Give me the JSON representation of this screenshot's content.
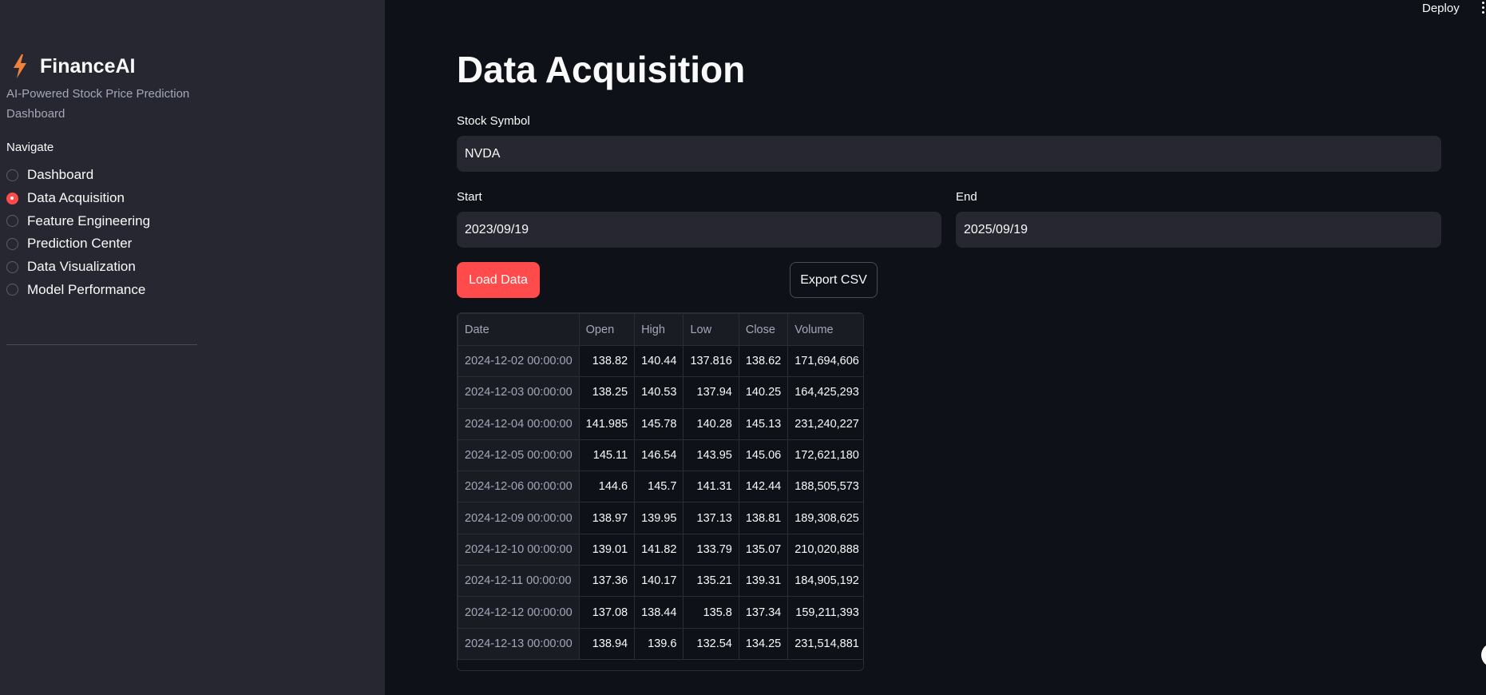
{
  "app": {
    "title": "FinanceAI",
    "tagline": "AI-Powered Stock Price Prediction Dashboard",
    "icon": "lightning-bolt-icon",
    "accent": "#ff4b4b",
    "bolt_color": "#f2823a"
  },
  "sidebar": {
    "nav_label": "Navigate",
    "items": [
      {
        "label": "Dashboard",
        "selected": false
      },
      {
        "label": "Data Acquisition",
        "selected": true
      },
      {
        "label": "Feature Engineering",
        "selected": false
      },
      {
        "label": "Prediction Center",
        "selected": false
      },
      {
        "label": "Data Visualization",
        "selected": false
      },
      {
        "label": "Model Performance",
        "selected": false
      }
    ]
  },
  "header": {
    "deploy_label": "Deploy",
    "menu_icon": "kebab-menu-icon"
  },
  "main": {
    "title": "Data Acquisition",
    "symbol_label": "Stock Symbol",
    "symbol_value": "NVDA",
    "start_label": "Start",
    "start_value": "2023/09/19",
    "end_label": "End",
    "end_value": "2025/09/19",
    "load_button": "Load Data",
    "export_button": "Export CSV"
  },
  "table": {
    "columns": [
      "Date",
      "Open",
      "High",
      "Low",
      "Close",
      "Volume"
    ],
    "rows": [
      [
        "2024-12-02 00:00:00",
        "138.82",
        "140.44",
        "137.816",
        "138.62",
        "171,694,606"
      ],
      [
        "2024-12-03 00:00:00",
        "138.25",
        "140.53",
        "137.94",
        "140.25",
        "164,425,293"
      ],
      [
        "2024-12-04 00:00:00",
        "141.985",
        "145.78",
        "140.28",
        "145.13",
        "231,240,227"
      ],
      [
        "2024-12-05 00:00:00",
        "145.11",
        "146.54",
        "143.95",
        "145.06",
        "172,621,180"
      ],
      [
        "2024-12-06 00:00:00",
        "144.6",
        "145.7",
        "141.31",
        "142.44",
        "188,505,573"
      ],
      [
        "2024-12-09 00:00:00",
        "138.97",
        "139.95",
        "137.13",
        "138.81",
        "189,308,625"
      ],
      [
        "2024-12-10 00:00:00",
        "139.01",
        "141.82",
        "133.79",
        "135.07",
        "210,020,888"
      ],
      [
        "2024-12-11 00:00:00",
        "137.36",
        "140.17",
        "135.21",
        "139.31",
        "184,905,192"
      ],
      [
        "2024-12-12 00:00:00",
        "137.08",
        "138.44",
        "135.8",
        "137.34",
        "159,211,393"
      ],
      [
        "2024-12-13 00:00:00",
        "138.94",
        "139.6",
        "132.54",
        "134.25",
        "231,514,881"
      ]
    ]
  }
}
